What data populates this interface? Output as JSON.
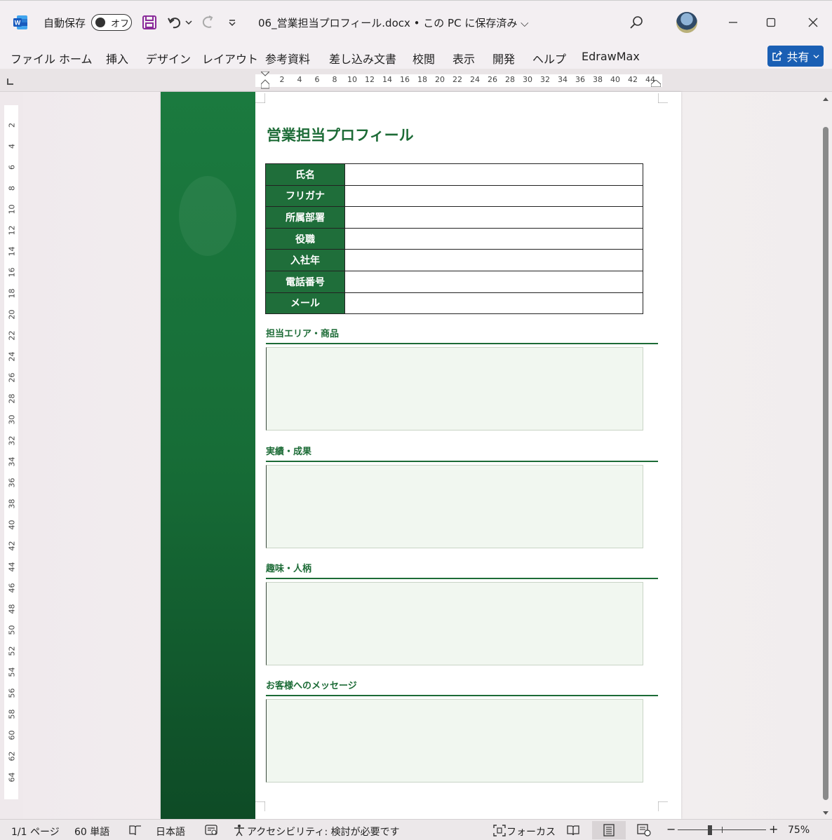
{
  "titlebar": {
    "autosave_label": "自動保存",
    "autosave_state": "オフ",
    "document_title": "06_営業担当プロフィール.docx • この PC に保存済み ⌵",
    "icons": [
      "word-logo-icon",
      "save-icon",
      "undo-icon",
      "redo-icon",
      "customize-icon",
      "search-icon",
      "minimize-icon",
      "maximize-icon",
      "close-icon"
    ]
  },
  "ribbon": {
    "tabs": [
      "ファイル",
      "ホーム",
      "挿入",
      "デザイン",
      "レイアウト",
      "参考資料",
      "差し込み文書",
      "校閲",
      "表示",
      "開発",
      "ヘルプ",
      "EdrawMax"
    ],
    "share_label": "共有"
  },
  "ruler": {
    "horizontal_ticks": [
      "2",
      "4",
      "6",
      "8",
      "10",
      "12",
      "14",
      "16",
      "18",
      "20",
      "22",
      "24",
      "26",
      "28",
      "30",
      "32",
      "34",
      "36",
      "38",
      "40",
      "42",
      "44"
    ],
    "vertical_ticks": [
      "2",
      "4",
      "6",
      "8",
      "10",
      "12",
      "14",
      "16",
      "18",
      "20",
      "22",
      "24",
      "26",
      "28",
      "30",
      "32",
      "34",
      "36",
      "38",
      "40",
      "42",
      "44",
      "46",
      "48",
      "50",
      "52",
      "54",
      "56",
      "58",
      "60",
      "62",
      "64"
    ]
  },
  "document": {
    "title": "営業担当プロフィール",
    "info_rows": [
      "氏名",
      "フリガナ",
      "所属部署",
      "役職",
      "入社年",
      "電話番号",
      "メール"
    ],
    "sections": [
      "担当エリア・商品",
      "実績・成果",
      "趣味・人柄",
      "お客様へのメッセージ"
    ],
    "accent_color": "#1c6b36"
  },
  "statusbar": {
    "page": "1/1 ページ",
    "words": "60 単語",
    "language": "日本語",
    "accessibility": "アクセシビリティ: 検討が必要です",
    "focus": "フォーカス",
    "zoom_minus": "−",
    "zoom_plus": "+",
    "zoom_level": "75%"
  }
}
